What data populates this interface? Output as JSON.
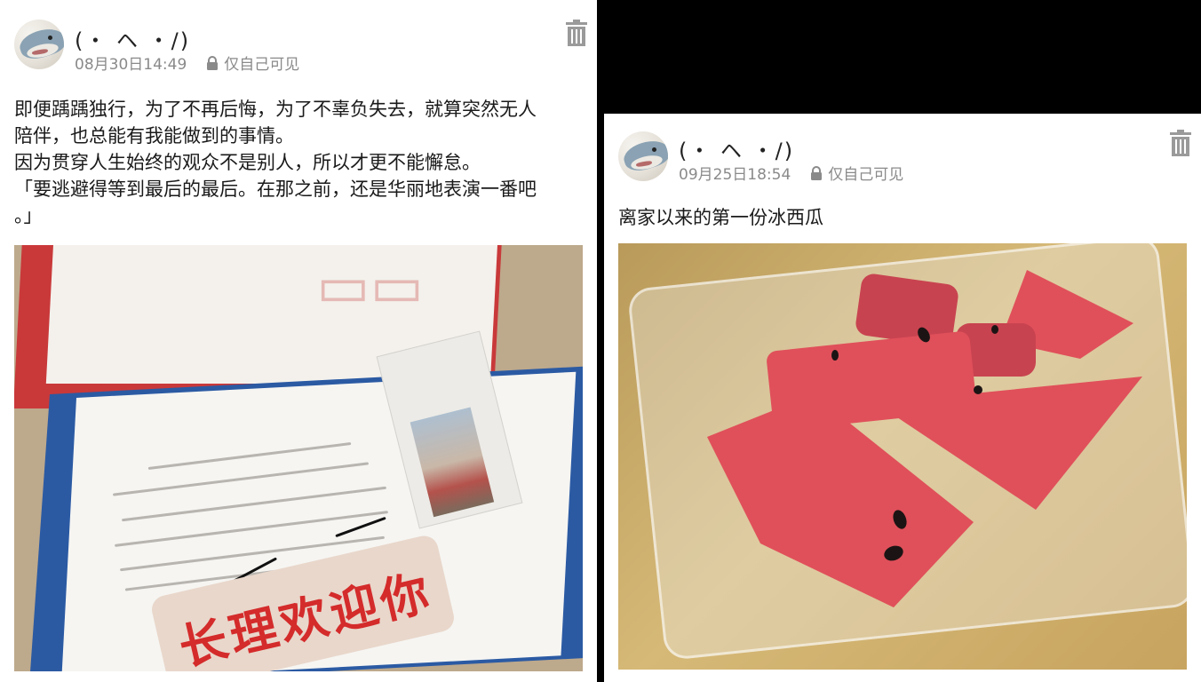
{
  "posts": [
    {
      "username": "(・ ヘ ・/)",
      "time": "08月30日14:49",
      "visibility": "仅自己可见",
      "text_lines": [
        "即便踽踽独行，为了不再后悔，为了不辜负失去，就算突然无人",
        "陪伴，也总能有我能做到的事情。",
        "因为贯穿人生始终的观众不是别人，所以才更不能懈怠。",
        "「要逃避得等到最后的最后。在那之前，还是华丽地表演一番吧",
        "。」"
      ],
      "photo": {
        "banner_text": "长理欢迎你"
      }
    },
    {
      "username": "(・ ヘ ・/)",
      "time": "09月25日18:54",
      "visibility": "仅自己可见",
      "text_lines": [
        "离家以来的第一份冰西瓜"
      ]
    }
  ],
  "icons": {
    "avatar": "shark-plush-avatar",
    "lock": "lock-icon",
    "delete": "trash-icon"
  },
  "colors": {
    "background": "#000000",
    "card": "#ffffff",
    "meta_gray": "#8a8a8a",
    "banner_red": "#d42b2b"
  }
}
